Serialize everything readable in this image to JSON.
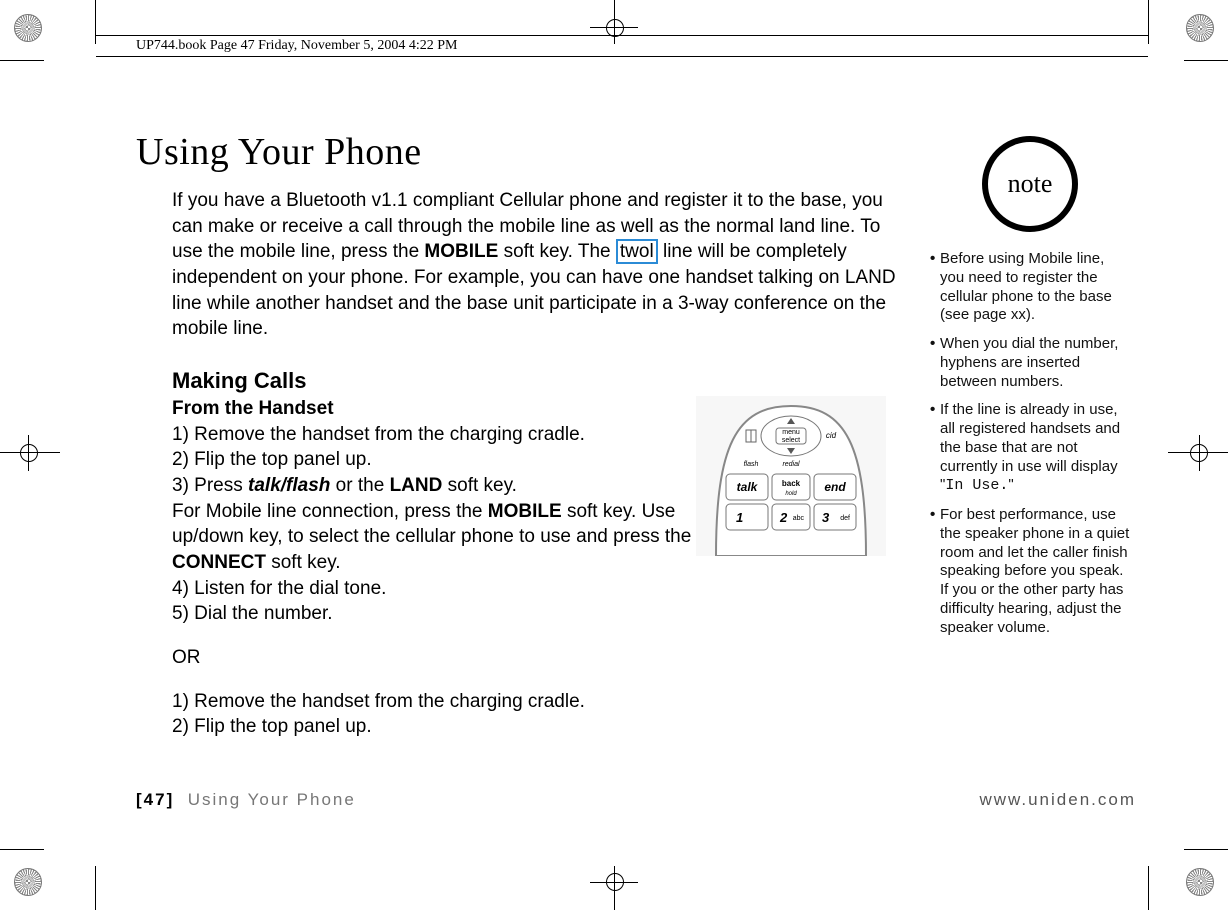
{
  "header_strip": "UP744.book  Page 47  Friday, November 5, 2004  4:22 PM",
  "title": "Using Your Phone",
  "intro_parts": {
    "p1": "If you have a Bluetooth v1.1 compliant Cellular phone and register it to the base, you can make or receive a call through the mobile line as well as the normal land line. To use the mobile line, press the ",
    "mobile": "MOBILE",
    "p2": " soft key. The ",
    "twol": "twol",
    "p3": " line will be completely independent on your phone. For example, you can have one handset talking on LAND line while another handset and the base unit participate in a 3-way conference on the mobile line."
  },
  "h2": "Making Calls",
  "h3": "From the Handset",
  "steps1": {
    "s1": "1) Remove the handset from the charging cradle.",
    "s2": "2) Flip the top panel up.",
    "s3a": "3) Press ",
    "talkflash": "talk/flash",
    "s3b": " or the ",
    "land": "LAND",
    "s3c": " soft key.",
    "mline_a": "For Mobile line connection, press the ",
    "mobile2": "MOBILE",
    "mline_b": " soft key. Use up/down key, to select the cellular phone to use and press the ",
    "connect": "CONNECT",
    "mline_c": " soft key.",
    "s4": "4) Listen for the dial tone.",
    "s5": "5) Dial the number."
  },
  "or_label": "OR",
  "steps2": {
    "s1": "1) Remove the handset from the charging cradle.",
    "s2": "2) Flip the top panel up."
  },
  "note_label": "note",
  "notes": {
    "n1": "Before using Mobile line, you need to register the cellular phone to the base (see page xx).",
    "n2": "When you dial the number, hyphens are inserted between numbers.",
    "n3a": "If the line is already in use, all registered handsets and the base that are not currently in use will display \"",
    "n3mono": "In Use.",
    "n3b": "\"",
    "n4": "For best performance, use the speaker phone in a quiet room and let the caller finish speaking before you speak. If you or the other party has difficulty hearing, adjust the speaker volume."
  },
  "footer": {
    "page": "[47]",
    "chapter": "Using Your Phone",
    "url": "www.uniden.com"
  },
  "phone_labels": {
    "menu": "menu",
    "select": "select",
    "cid": "cid",
    "flash": "flash",
    "redial": "redial",
    "back": "back",
    "hold": "hold",
    "talk": "talk",
    "end": "end",
    "k1": "1",
    "k2": "2",
    "abc": "abc",
    "k3": "3",
    "def": "def"
  }
}
